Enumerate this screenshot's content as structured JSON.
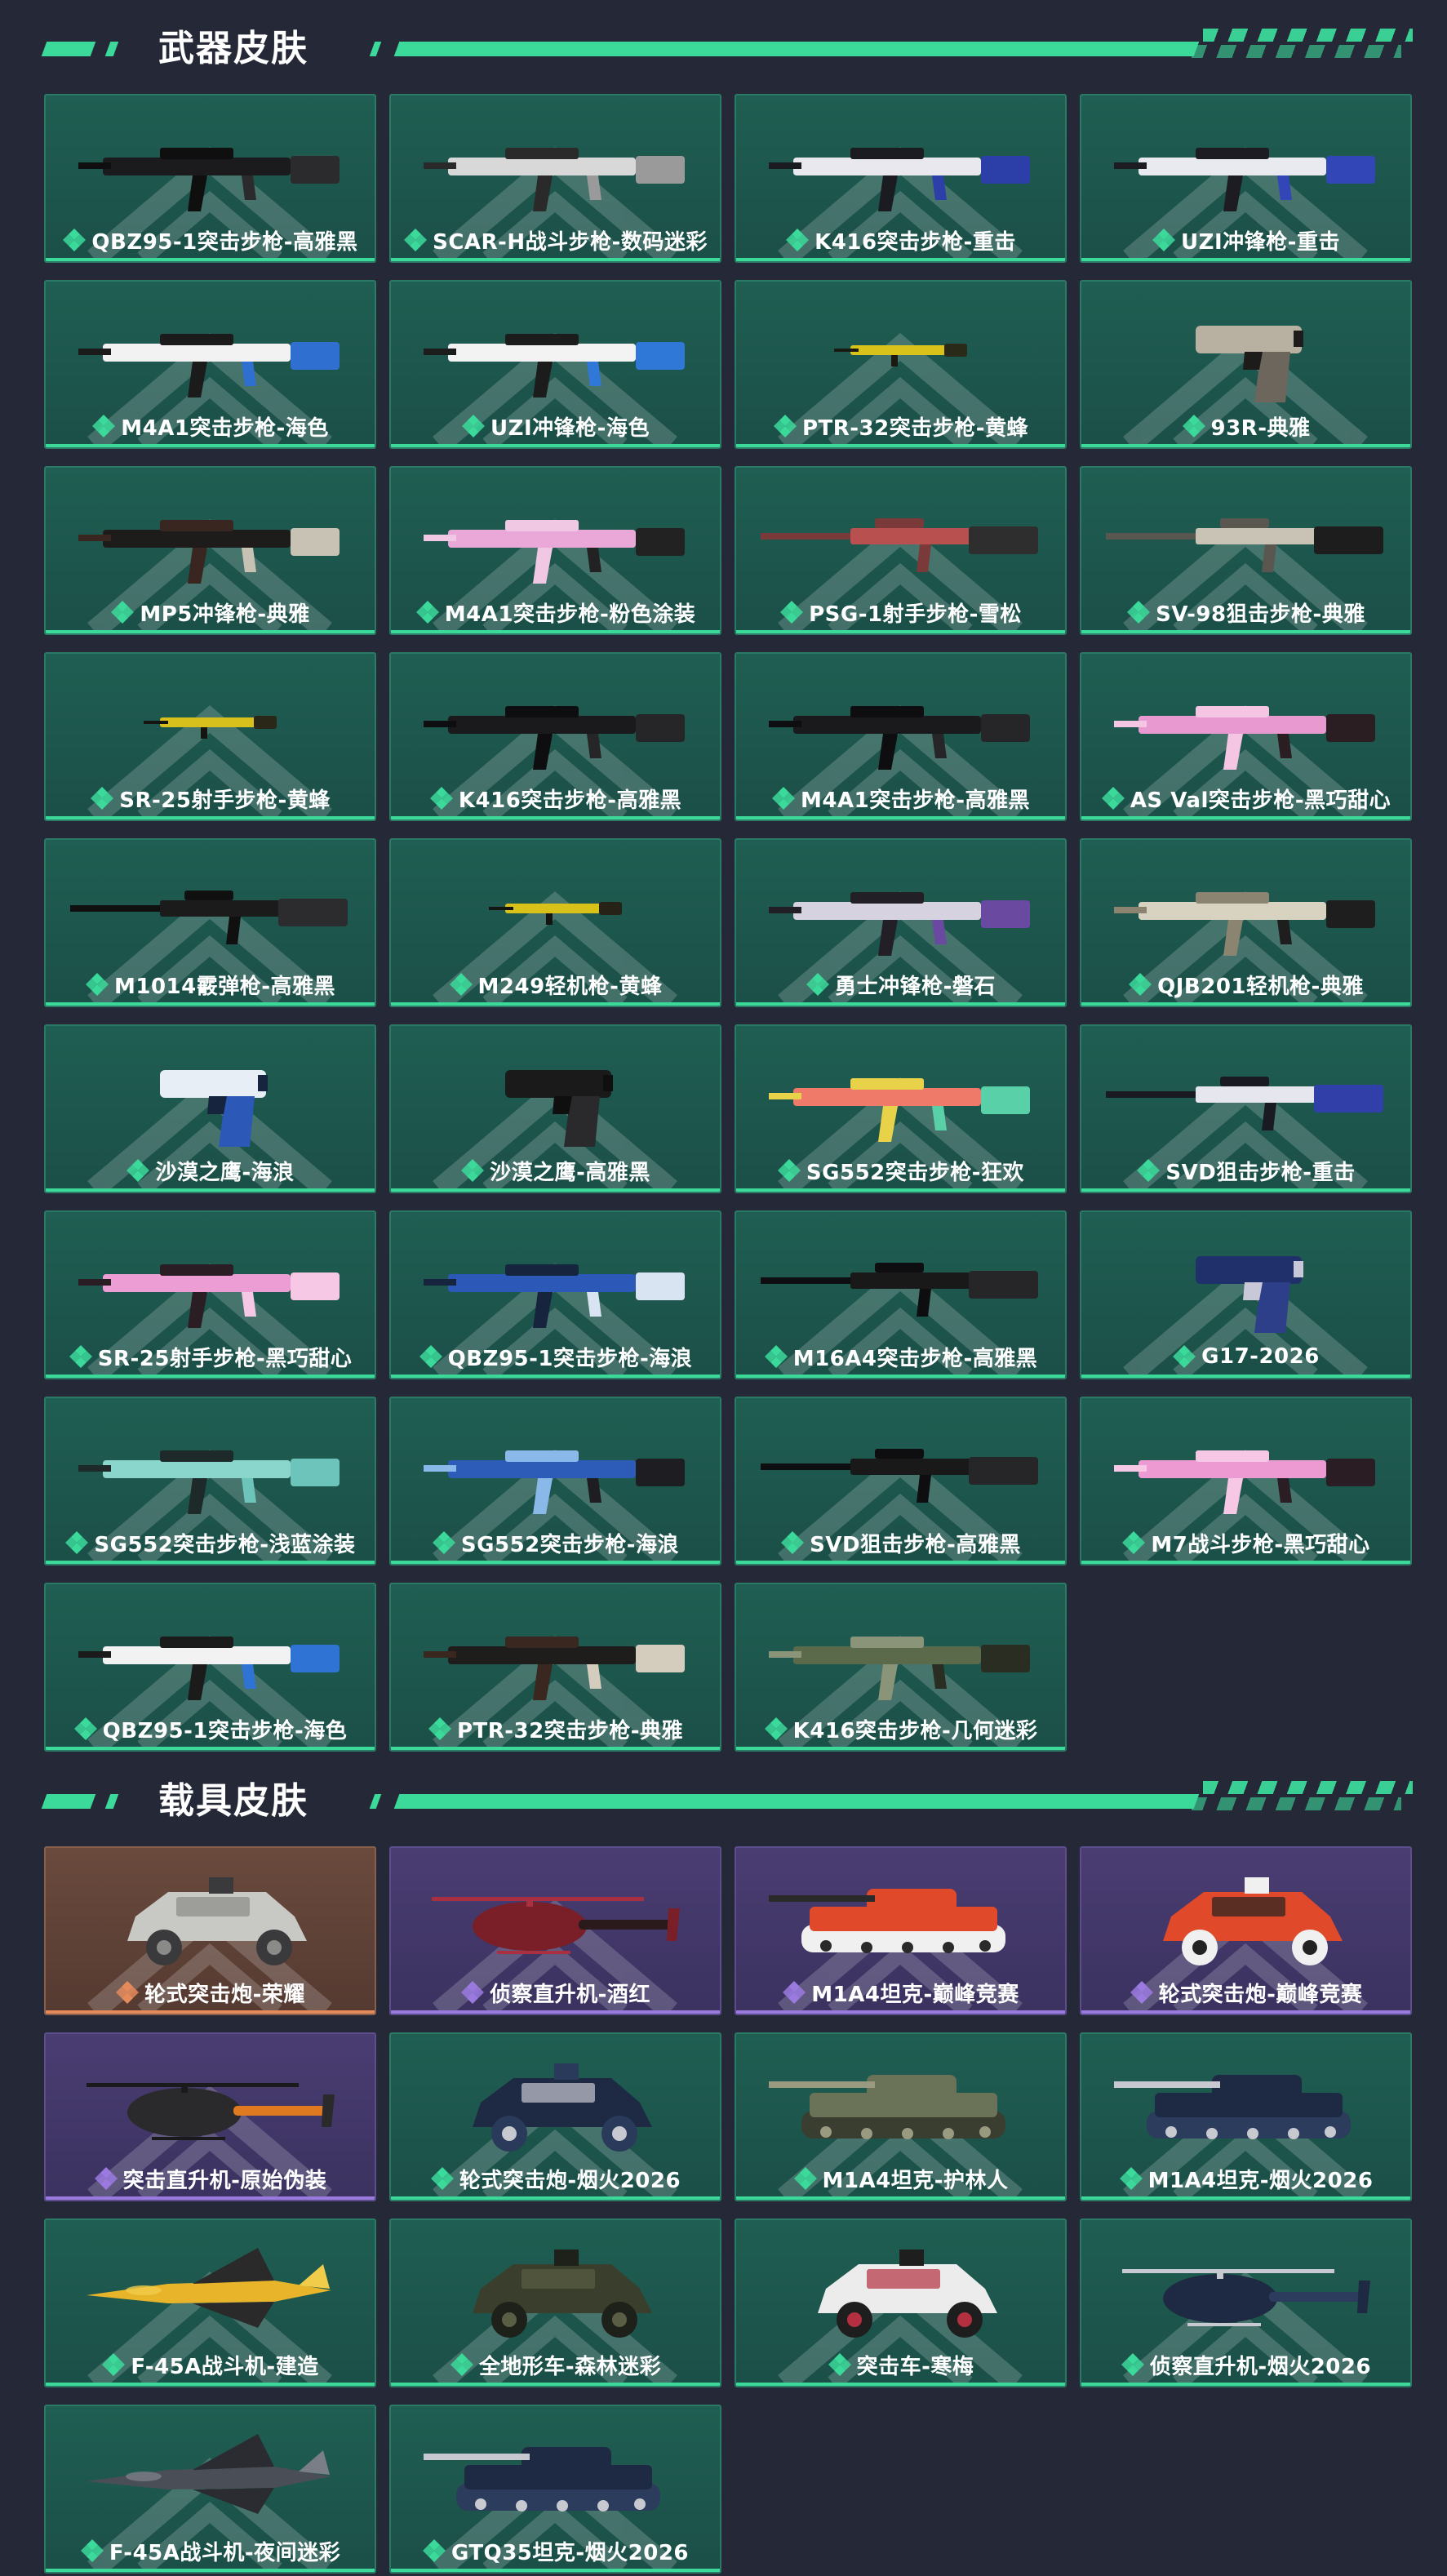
{
  "sections": [
    {
      "title": "武器皮肤",
      "items": [
        {
          "name": "QBZ95-1突击步枪-高雅黑",
          "rarity": "green",
          "palette": [
            "#1b1b1d",
            "#2b2b2e",
            "#0f0f10"
          ],
          "kind": "rifle"
        },
        {
          "name": "SCAR-H战斗步枪-数码迷彩",
          "rarity": "green",
          "palette": [
            "#d8d8d8",
            "#9a9a9a",
            "#2a2a2a"
          ],
          "kind": "rifle"
        },
        {
          "name": "K416突击步枪-重击",
          "rarity": "green",
          "palette": [
            "#e8e8ee",
            "#2c3fa8",
            "#1b1b22"
          ],
          "kind": "rifle"
        },
        {
          "name": "UZI冲锋枪-重击",
          "rarity": "green",
          "palette": [
            "#e9e9f0",
            "#3346b8",
            "#1c1c22"
          ],
          "kind": "rifle"
        },
        {
          "name": "M4A1突击步枪-海色",
          "rarity": "green",
          "palette": [
            "#f2f2f2",
            "#2f6fd0",
            "#1b1b1b"
          ],
          "kind": "rifle"
        },
        {
          "name": "UZI冲锋枪-海色",
          "rarity": "green",
          "palette": [
            "#f3f3f3",
            "#2f78d8",
            "#1c1c1c"
          ],
          "kind": "rifle"
        },
        {
          "name": "PTR-32突击步枪-黄蜂",
          "rarity": "green",
          "palette": [
            "#d9c21a",
            "#2a2a18",
            "#1a1a12"
          ],
          "kind": "small"
        },
        {
          "name": "93R-典雅",
          "rarity": "green",
          "palette": [
            "#b8b0a0",
            "#6c665c",
            "#1e1c1a"
          ],
          "kind": "pistol"
        },
        {
          "name": "MP5冲锋枪-典雅",
          "rarity": "green",
          "palette": [
            "#1e1c1b",
            "#c8c2b4",
            "#3a2620"
          ],
          "kind": "rifle"
        },
        {
          "name": "M4A1突击步枪-粉色涂装",
          "rarity": "green",
          "palette": [
            "#e9a8d8",
            "#222222",
            "#f0c8e4"
          ],
          "kind": "rifle"
        },
        {
          "name": "PSG-1射手步枪-雪松",
          "rarity": "green",
          "palette": [
            "#b85050",
            "#2e2e2e",
            "#7a3a3a"
          ],
          "kind": "long"
        },
        {
          "name": "SV-98狙击步枪-典雅",
          "rarity": "green",
          "palette": [
            "#c9c3b6",
            "#1d1d1d",
            "#5a5650"
          ],
          "kind": "long"
        },
        {
          "name": "SR-25射手步枪-黄蜂",
          "rarity": "green",
          "palette": [
            "#d8c01c",
            "#2a2618",
            "#141410"
          ],
          "kind": "small"
        },
        {
          "name": "K416突击步枪-高雅黑",
          "rarity": "green",
          "palette": [
            "#1a1a1c",
            "#262628",
            "#0e0e10"
          ],
          "kind": "rifle"
        },
        {
          "name": "M4A1突击步枪-高雅黑",
          "rarity": "green",
          "palette": [
            "#1a1a1c",
            "#262628",
            "#0e0e10"
          ],
          "kind": "rifle"
        },
        {
          "name": "AS Val突击步枪-黑巧甜心",
          "rarity": "green",
          "palette": [
            "#e89ad0",
            "#2a1e22",
            "#f4c6e4"
          ],
          "kind": "rifle"
        },
        {
          "name": "M1014霰弹枪-高雅黑",
          "rarity": "green",
          "palette": [
            "#1b1b1c",
            "#2c2c2e",
            "#101010"
          ],
          "kind": "long"
        },
        {
          "name": "M249轻机枪-黄蜂",
          "rarity": "green",
          "palette": [
            "#d8c21a",
            "#262218",
            "#141410"
          ],
          "kind": "small"
        },
        {
          "name": "勇士冲锋枪-磐石",
          "rarity": "green",
          "palette": [
            "#d6d2e0",
            "#6a4aa0",
            "#222026"
          ],
          "kind": "rifle"
        },
        {
          "name": "QJB201轻机枪-典雅",
          "rarity": "green",
          "palette": [
            "#d8d2c0",
            "#1e1e1e",
            "#8a8470"
          ],
          "kind": "rifle"
        },
        {
          "name": "沙漠之鹰-海浪",
          "rarity": "green",
          "palette": [
            "#e8eef6",
            "#2c58b8",
            "#16243e"
          ],
          "kind": "pistol"
        },
        {
          "name": "沙漠之鹰-高雅黑",
          "rarity": "green",
          "palette": [
            "#1a1a1b",
            "#2a2a2c",
            "#0f0f10"
          ],
          "kind": "pistol"
        },
        {
          "name": "SG552突击步枪-狂欢",
          "rarity": "green",
          "palette": [
            "#f07a6a",
            "#5ad0a8",
            "#e8d24a"
          ],
          "kind": "rifle"
        },
        {
          "name": "SVD狙击步枪-重击",
          "rarity": "green",
          "palette": [
            "#e6e6ee",
            "#3040a8",
            "#1a1a22"
          ],
          "kind": "long"
        },
        {
          "name": "SR-25射手步枪-黑巧甜心",
          "rarity": "green",
          "palette": [
            "#ec9ed4",
            "#f6c8e6",
            "#2a1e24"
          ],
          "kind": "rifle"
        },
        {
          "name": "QBZ95-1突击步枪-海浪",
          "rarity": "green",
          "palette": [
            "#2c58b8",
            "#d8e4f2",
            "#16243e"
          ],
          "kind": "rifle"
        },
        {
          "name": "M16A4突击步枪-高雅黑",
          "rarity": "green",
          "palette": [
            "#19191a",
            "#262628",
            "#0e0e10"
          ],
          "kind": "long"
        },
        {
          "name": "G17-2026",
          "rarity": "green",
          "palette": [
            "#20306a",
            "#2c3f88",
            "#c8c8d8"
          ],
          "kind": "pistol"
        },
        {
          "name": "SG552突击步枪-浅蓝涂装",
          "rarity": "green",
          "palette": [
            "#8ad6cc",
            "#6cc4ba",
            "#1e2a2a"
          ],
          "kind": "rifle"
        },
        {
          "name": "SG552突击步枪-海浪",
          "rarity": "green",
          "palette": [
            "#2c5cb8",
            "#1e1e22",
            "#8ab8e8"
          ],
          "kind": "rifle"
        },
        {
          "name": "SVD狙击步枪-高雅黑",
          "rarity": "green",
          "palette": [
            "#19191a",
            "#262628",
            "#0e0e10"
          ],
          "kind": "long"
        },
        {
          "name": "M7战斗步枪-黑巧甜心",
          "rarity": "green",
          "palette": [
            "#ee9ad2",
            "#2a1e24",
            "#f6c8e6"
          ],
          "kind": "rifle"
        },
        {
          "name": "QBZ95-1突击步枪-海色",
          "rarity": "green",
          "palette": [
            "#f2f2f2",
            "#2f74d4",
            "#1b1b1b"
          ],
          "kind": "rifle"
        },
        {
          "name": "PTR-32突击步枪-典雅",
          "rarity": "green",
          "palette": [
            "#1e1d1c",
            "#d4cdbd",
            "#3a2820"
          ],
          "kind": "rifle"
        },
        {
          "name": "K416突击步枪-几何迷彩",
          "rarity": "green",
          "palette": [
            "#5a6a4a",
            "#2a2e22",
            "#8a9478"
          ],
          "kind": "rifle"
        }
      ]
    },
    {
      "title": "载具皮肤",
      "items": [
        {
          "name": "轮式突击炮-荣耀",
          "rarity": "orange",
          "palette": [
            "#c8c8c4",
            "#3a3a3c",
            "#8a8a88"
          ],
          "kind": "car"
        },
        {
          "name": "侦察直升机-酒红",
          "rarity": "purple",
          "palette": [
            "#7a1e28",
            "#2a1a1c",
            "#a83040"
          ],
          "kind": "heli"
        },
        {
          "name": "M1A4坦克-巅峰竞赛",
          "rarity": "purple",
          "palette": [
            "#e04a2a",
            "#f0f0f0",
            "#2a2a2a"
          ],
          "kind": "tank"
        },
        {
          "name": "轮式突击炮-巅峰竞赛",
          "rarity": "purple",
          "palette": [
            "#e04a2a",
            "#f0f0f0",
            "#222222"
          ],
          "kind": "car"
        },
        {
          "name": "突击直升机-原始伪装",
          "rarity": "purple",
          "palette": [
            "#2a2a2c",
            "#e07a20",
            "#1a1a1c"
          ],
          "kind": "heli"
        },
        {
          "name": "轮式突击炮-烟火2026",
          "rarity": "green",
          "palette": [
            "#1e2a44",
            "#2a3a5a",
            "#c8c8d0"
          ],
          "kind": "car"
        },
        {
          "name": "M1A4坦克-护林人",
          "rarity": "green",
          "palette": [
            "#6a7258",
            "#3a3e30",
            "#9a9a80"
          ],
          "kind": "tank"
        },
        {
          "name": "M1A4坦克-烟火2026",
          "rarity": "green",
          "palette": [
            "#1e2a44",
            "#2c3c5c",
            "#c8c8d0"
          ],
          "kind": "tank"
        },
        {
          "name": "F-45A战斗机-建造",
          "rarity": "green",
          "palette": [
            "#e8b42a",
            "#2a2a2a",
            "#f0cc4a"
          ],
          "kind": "jet"
        },
        {
          "name": "全地形车-森林迷彩",
          "rarity": "green",
          "palette": [
            "#3a3e2c",
            "#1e201a",
            "#5a5e44"
          ],
          "kind": "car"
        },
        {
          "name": "突击车-寒梅",
          "rarity": "green",
          "palette": [
            "#ececec",
            "#1e1e1e",
            "#b43040"
          ],
          "kind": "car"
        },
        {
          "name": "侦察直升机-烟火2026",
          "rarity": "green",
          "palette": [
            "#1e2a44",
            "#2c3c5c",
            "#c8c8d0"
          ],
          "kind": "heli"
        },
        {
          "name": "F-45A战斗机-夜间迷彩",
          "rarity": "green",
          "palette": [
            "#4a4e56",
            "#2a2c32",
            "#7a7e86"
          ],
          "kind": "jet"
        },
        {
          "name": "GTQ35坦克-烟火2026",
          "rarity": "green",
          "palette": [
            "#1e2a44",
            "#2c3c5c",
            "#c8c8d0"
          ],
          "kind": "tank"
        }
      ]
    }
  ],
  "rarity_colors": {
    "green": "#3bd99a",
    "purple": "#9b7ae0",
    "orange": "#e58a5b"
  }
}
